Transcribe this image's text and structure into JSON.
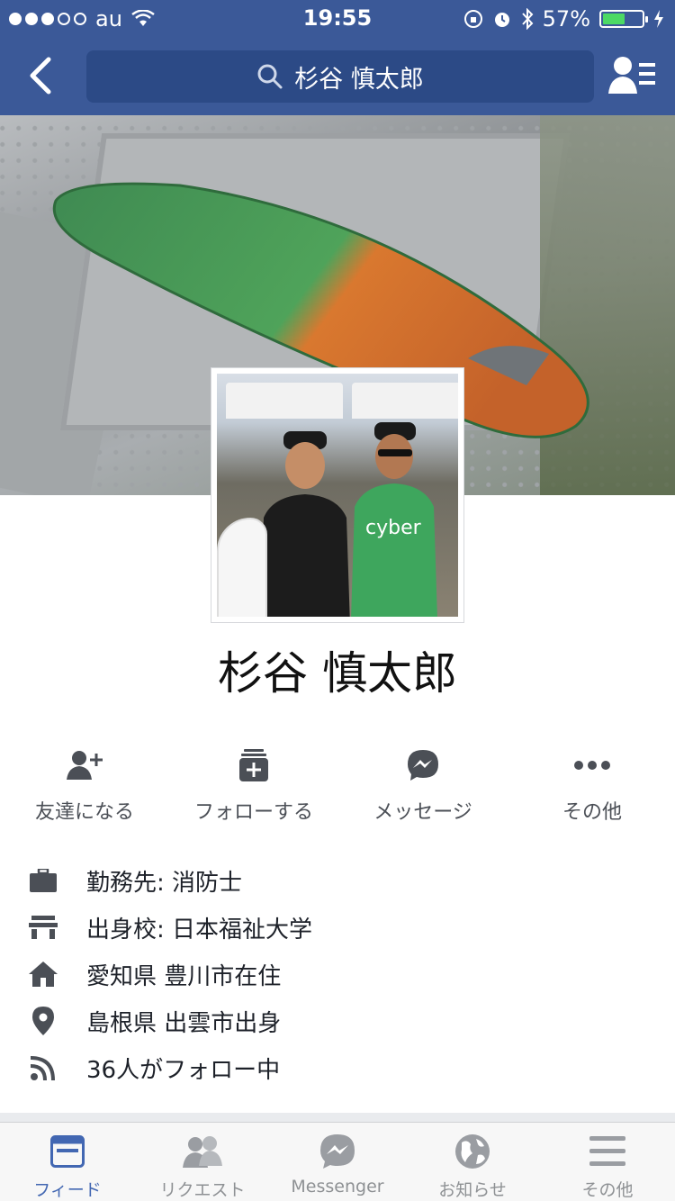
{
  "status_bar": {
    "carrier": "au",
    "time": "19:55",
    "battery": "57%",
    "battery_level": 0.57
  },
  "nav": {
    "search_text": "杉谷 慎太郎"
  },
  "profile": {
    "name": "杉谷 慎太郎"
  },
  "actions": [
    {
      "label": "友達になる",
      "icon": "add-friend-icon"
    },
    {
      "label": "フォローする",
      "icon": "follow-icon"
    },
    {
      "label": "メッセージ",
      "icon": "messenger-icon"
    },
    {
      "label": "その他",
      "icon": "more-icon"
    }
  ],
  "info": [
    {
      "text": "勤務先: 消防士",
      "icon": "briefcase-icon"
    },
    {
      "text": "出身校: 日本福祉大学",
      "icon": "school-icon"
    },
    {
      "text": "愛知県 豊川市在住",
      "icon": "home-icon"
    },
    {
      "text": "島根県 出雲市出身",
      "icon": "location-pin-icon"
    },
    {
      "text": "36人がフォロー中",
      "icon": "rss-icon"
    }
  ],
  "tabs": [
    {
      "label": "フィード",
      "icon": "feed-icon",
      "active": true
    },
    {
      "label": "リクエスト",
      "icon": "friend-requests-icon",
      "active": false
    },
    {
      "label": "Messenger",
      "icon": "messenger-icon",
      "active": false
    },
    {
      "label": "お知らせ",
      "icon": "globe-icon",
      "active": false
    },
    {
      "label": "その他",
      "icon": "menu-icon",
      "active": false
    }
  ],
  "colors": {
    "brand": "#3b5998",
    "active_tab": "#4267b2",
    "icon_gray": "#4b4f56"
  }
}
